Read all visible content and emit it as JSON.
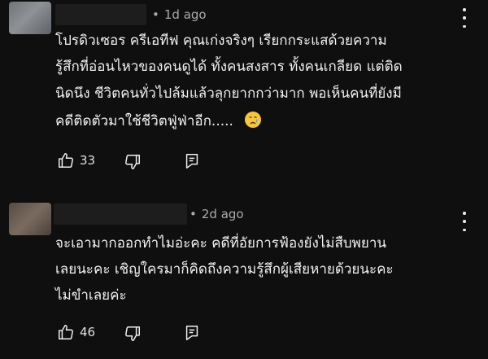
{
  "comments": [
    {
      "time": "1d ago",
      "separator": "•",
      "lines": [
        "โปรดิวเซอร ครีเอทีฟ คุณเก่งจริงๆ เรียกกระแสด้วยความ",
        "รู้สึกที่อ่อนไหวของคนดูได้ ทั้งคนสงสาร ทั้งคนเกลียด แต่ติด",
        "นิดนึง ชีวิตคนทั่วไปล้มแล้วลุกยากกว่ามาก พอเห็นคนที่ยังมี",
        "คดีติดตัวมาใช้ชีวิตฟู่ฟ่าอีก....."
      ],
      "emoji": "crying-face",
      "likes": "33"
    },
    {
      "time": "2d ago",
      "separator": "•",
      "lines": [
        "จะเอามากออกทำไมอ่ะคะ คดีที่อัยการฟ้องยังไม่สืบพยาน",
        "เลยนะคะ เชิญใครมาก็คิดถึงความรู้สึกผู้เสียหายด้วยนะคะ",
        "ไม่ขำเลยค่ะ"
      ],
      "likes": "46"
    }
  ],
  "icons": {
    "like": "thumbs-up-icon",
    "dislike": "thumbs-down-icon",
    "reply": "reply-icon",
    "menu": "more-vertical-icon"
  },
  "colors": {
    "background": "#0f0f0f",
    "text": "#f1f1f1",
    "meta": "#aaaaaa"
  }
}
